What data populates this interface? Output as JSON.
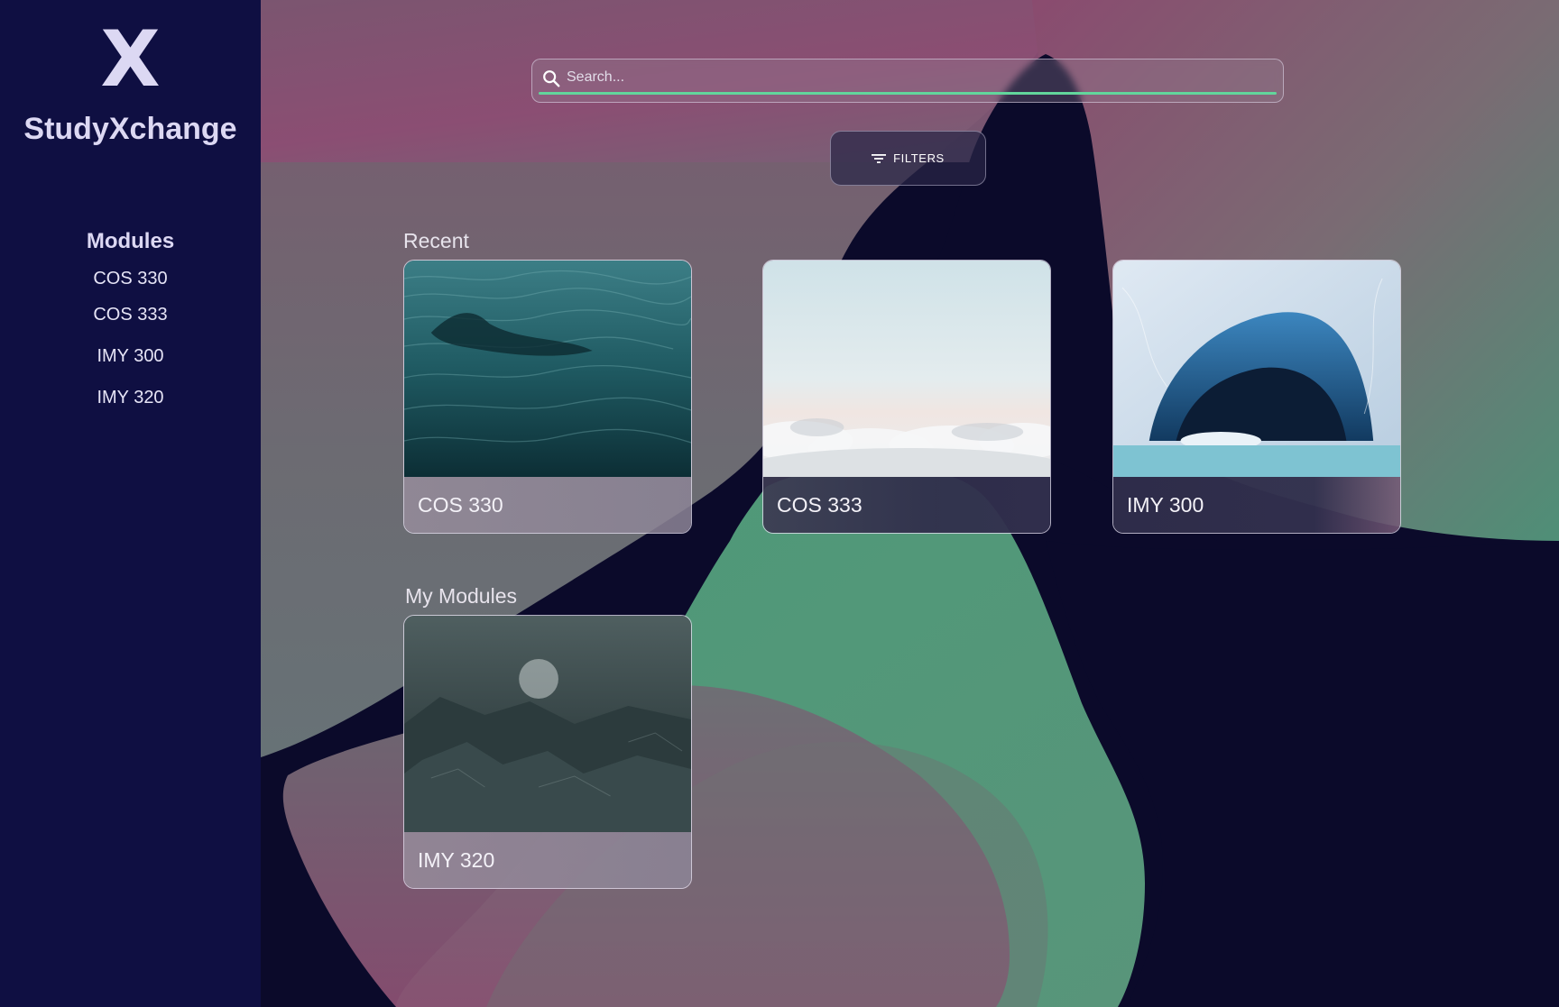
{
  "brand": {
    "logo_mark": "X",
    "name": "StudyXchange"
  },
  "sidebar": {
    "title": "Modules",
    "items": [
      {
        "label": "COS 330"
      },
      {
        "label": "COS 333"
      },
      {
        "label": "IMY 300"
      },
      {
        "label": "IMY 320"
      }
    ]
  },
  "search": {
    "placeholder": "Search...",
    "value": ""
  },
  "filters": {
    "label": "FILTERS"
  },
  "sections": {
    "recent": {
      "title": "Recent",
      "cards": [
        {
          "label": "COS 330",
          "image": "ocean-water"
        },
        {
          "label": "COS 333",
          "image": "sky-clouds"
        },
        {
          "label": "IMY 300",
          "image": "ice-cave"
        }
      ]
    },
    "my_modules": {
      "title": "My Modules",
      "cards": [
        {
          "label": "IMY 320",
          "image": "dark-rocks"
        }
      ]
    }
  },
  "colors": {
    "sidebar": "#0f0f42",
    "background_dark": "#0b0a2a",
    "blob_pink": "#8a4f74",
    "blob_green": "#4f9a78",
    "accent_green": "#62d69c"
  }
}
